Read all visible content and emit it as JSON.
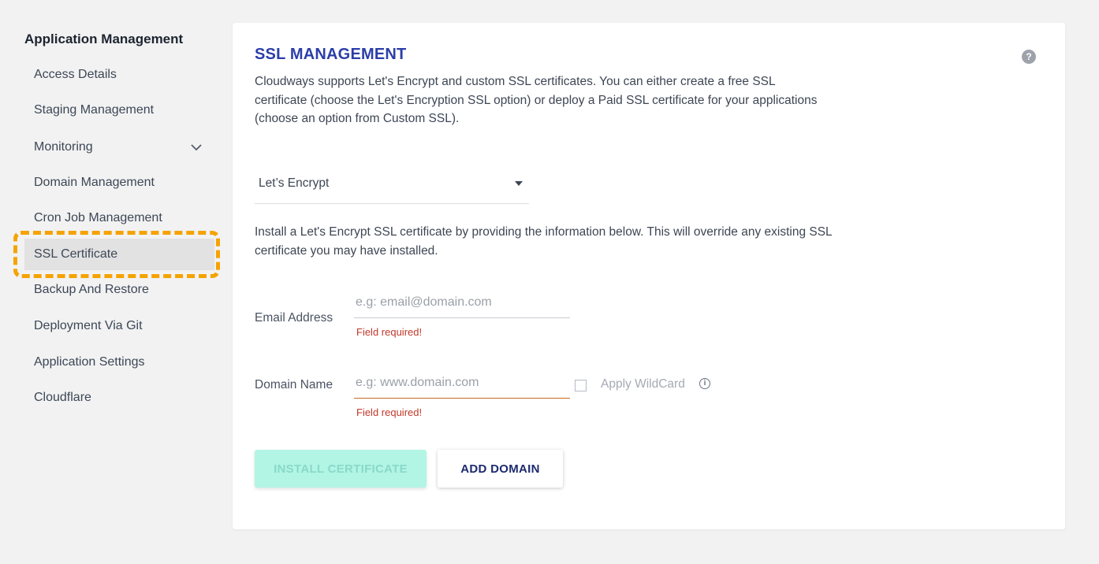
{
  "sidebar": {
    "title": "Application Management",
    "items": [
      {
        "label": "Access Details"
      },
      {
        "label": "Staging Management"
      },
      {
        "label": "Monitoring"
      },
      {
        "label": "Domain Management"
      },
      {
        "label": "Cron Job Management"
      },
      {
        "label": "SSL Certificate"
      },
      {
        "label": "Backup And Restore"
      },
      {
        "label": "Deployment Via Git"
      },
      {
        "label": "Application Settings"
      },
      {
        "label": "Cloudflare"
      }
    ],
    "active_item": "SSL Certificate"
  },
  "ssl": {
    "title": "SSL MANAGEMENT",
    "help_icon": "?",
    "description": "Cloudways supports Let's Encrypt and custom SSL certificates. You can either create a free SSL certificate (choose the Let's Encryption SSL option) or deploy a Paid SSL certificate for your applications (choose an option from Custom SSL).",
    "provider_select": {
      "value": "Let’s Encrypt"
    },
    "info": "Install a Let's Encrypt SSL certificate by providing the information below. This will override any existing SSL certificate you may have installed.",
    "email": {
      "label": "Email Address",
      "placeholder": "e.g: email@domain.com",
      "value": "",
      "error": "Field required!"
    },
    "domain": {
      "label": "Domain Name",
      "placeholder": "e.g: www.domain.com",
      "value": "",
      "error": "Field required!"
    },
    "wildcard": {
      "label": "Apply WildCard",
      "checked": false,
      "info_icon": "i"
    },
    "buttons": {
      "install": "INSTALL CERTIFICATE",
      "add_domain": "ADD DOMAIN"
    }
  },
  "colors": {
    "title": "#2b3ea8",
    "highlight": "#f5a300",
    "error": "#c0392b",
    "install_button": "#b2f5e5"
  }
}
